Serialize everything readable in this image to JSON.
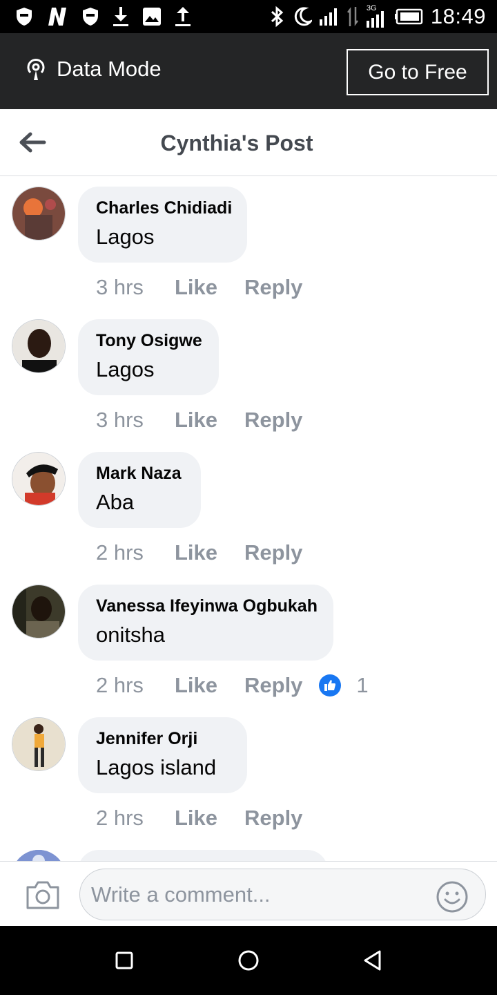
{
  "status_bar": {
    "time": "18:49",
    "left_icons": [
      "shield-icon",
      "n-app-icon",
      "shield-icon",
      "download-icon",
      "image-icon",
      "upload-icon"
    ],
    "right_icons": [
      "bluetooth-icon",
      "moon-icon",
      "signal-icon",
      "data-arrows-icon",
      "signal-3g-icon",
      "battery-icon"
    ],
    "network_label": "3G"
  },
  "data_bar": {
    "mode_label": "Data Mode",
    "go_free_label": "Go to Free"
  },
  "header": {
    "title": "Cynthia's Post"
  },
  "comments": [
    {
      "author": "Charles Chidiadi",
      "text": "Lagos",
      "time": "3 hrs",
      "like_label": "Like",
      "reply_label": "Reply",
      "reaction_count": null
    },
    {
      "author": "Tony Osigwe",
      "text": "Lagos",
      "time": "3 hrs",
      "like_label": "Like",
      "reply_label": "Reply",
      "reaction_count": null
    },
    {
      "author": "Mark Naza",
      "text": "Aba",
      "time": "2 hrs",
      "like_label": "Like",
      "reply_label": "Reply",
      "reaction_count": null
    },
    {
      "author": "Vanessa Ifeyinwa Ogbukah",
      "text": "onitsha",
      "time": "2 hrs",
      "like_label": "Like",
      "reply_label": "Reply",
      "reaction_count": "1"
    },
    {
      "author": "Jennifer Orji",
      "text": "Lagos island",
      "time": "2 hrs",
      "like_label": "Like",
      "reply_label": "Reply",
      "reaction_count": null
    }
  ],
  "composer": {
    "placeholder": "Write a comment..."
  },
  "colors": {
    "status_bar": "#000000",
    "data_bar": "#242526",
    "bubble": "#f0f2f5",
    "secondary_text": "#8d949e",
    "like_blue": "#1877f2"
  }
}
